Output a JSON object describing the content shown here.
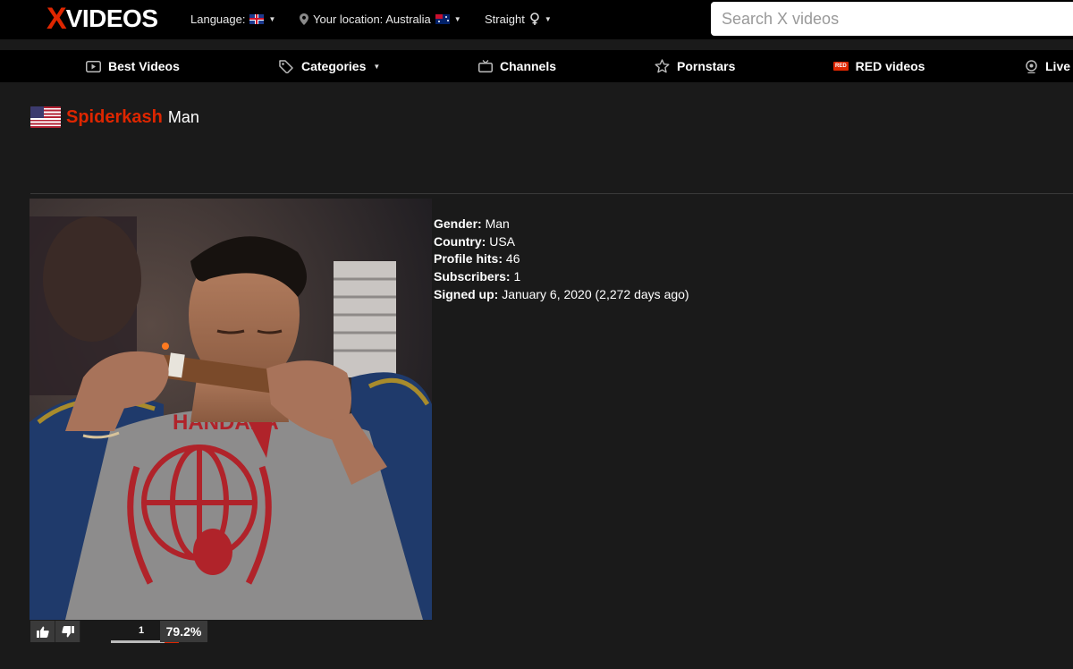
{
  "header": {
    "logo_x": "X",
    "logo_rest": "VIDEOS",
    "language_label": "Language:",
    "location_label": "Your location: Australia",
    "orientation_label": "Straight",
    "search_placeholder": "Search X videos"
  },
  "nav": {
    "items": [
      {
        "label": "Best Videos",
        "icon": "play-icon"
      },
      {
        "label": "Categories",
        "icon": "tag-icon"
      },
      {
        "label": "Channels",
        "icon": "tv-icon"
      },
      {
        "label": "Pornstars",
        "icon": "star-icon"
      },
      {
        "label": "RED videos",
        "icon": "red-badge-icon"
      },
      {
        "label": "Live",
        "icon": "webcam-icon"
      }
    ],
    "red_badge_text": "RED"
  },
  "profile": {
    "username": "Spiderkash",
    "gender_tag": "Man",
    "flag": "us-flag-icon",
    "details": [
      {
        "label": "Gender:",
        "value": "Man"
      },
      {
        "label": "Country:",
        "value": "USA"
      },
      {
        "label": "Profile hits:",
        "value": "46"
      },
      {
        "label": "Subscribers:",
        "value": "1"
      },
      {
        "label": "Signed up:",
        "value": "January 6, 2020 (2,272 days ago)"
      }
    ],
    "photo_caption_text": "HANDALA",
    "votes": {
      "count": "1",
      "rating": "79.2%",
      "positive_fraction": 0.792
    }
  },
  "colors": {
    "brand_red": "#de2600",
    "background": "#1a1a1a",
    "topbar": "#000000"
  }
}
